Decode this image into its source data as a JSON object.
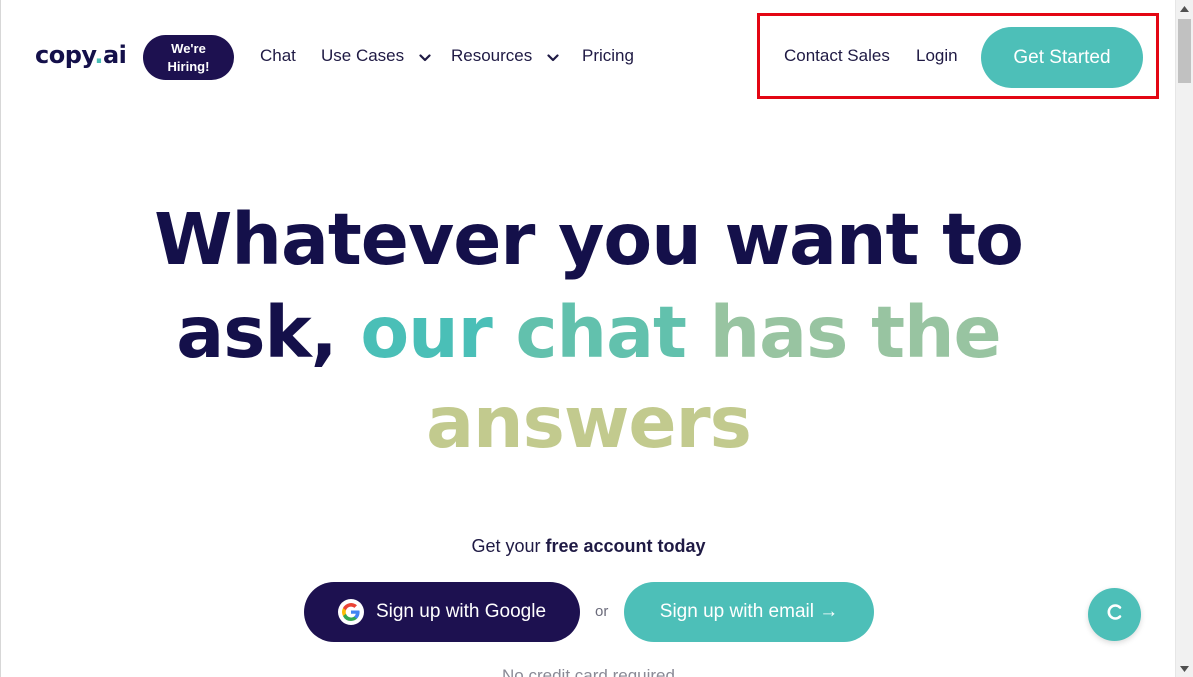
{
  "header": {
    "logo_main": "copy",
    "logo_dot": ".",
    "logo_suffix": "ai",
    "hiring_line1": "We're",
    "hiring_line2": "Hiring!",
    "nav": {
      "chat": "Chat",
      "use_cases": "Use Cases",
      "resources": "Resources",
      "pricing": "Pricing"
    },
    "contact_sales": "Contact Sales",
    "login": "Login",
    "get_started": "Get Started"
  },
  "hero": {
    "line1": "Whatever you want to",
    "line2_dark": "ask,",
    "line2_w1": "our",
    "line2_w2": "chat",
    "line2_w3": "has the",
    "line3": "answers"
  },
  "signup": {
    "prompt_prefix": "Get your",
    "prompt_bold": "free account today",
    "google_button": "Sign up with Google",
    "or": "or",
    "email_button": "Sign up with email →",
    "fineprint": "No credit card required"
  },
  "colors": {
    "brand_dark": "#1d1150",
    "accent_teal": "#4dbfb8",
    "highlight_border": "#e30613"
  },
  "icons": {
    "dropdown": "chevron-down-icon",
    "google": "google-g-icon",
    "chat_widget": "chat-bubble-icon"
  }
}
